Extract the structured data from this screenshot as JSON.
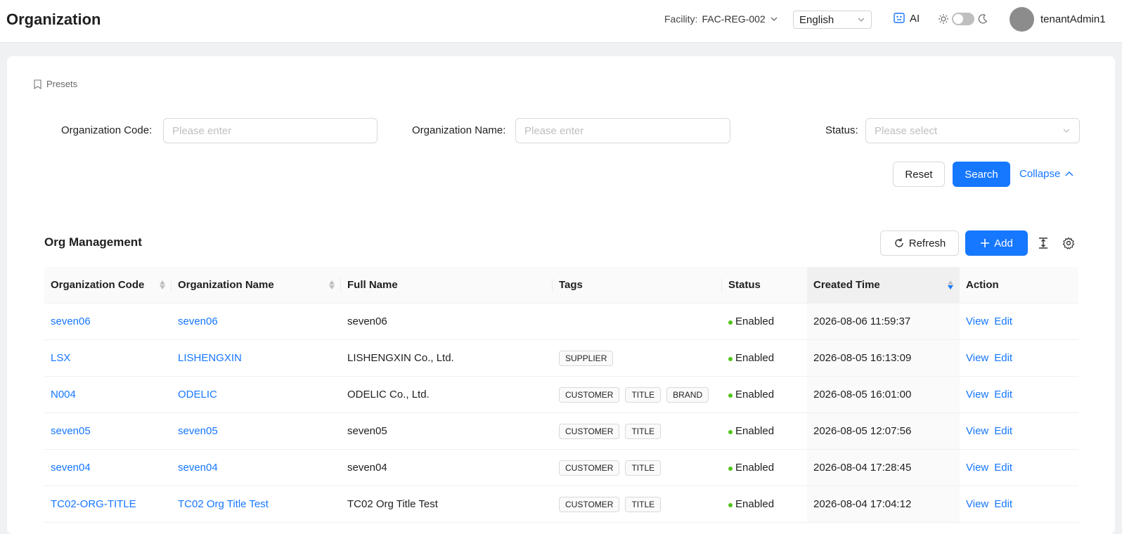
{
  "header": {
    "title": "Organization",
    "facility_label": "Facility:",
    "facility_value": "FAC-REG-002",
    "language": "English",
    "ai_label": "AI",
    "username": "tenantAdmin1"
  },
  "presets_label": "Presets",
  "filters": {
    "org_code_label": "Organization Code",
    "org_code_placeholder": "Please enter",
    "org_name_label": "Organization Name",
    "org_name_placeholder": "Please enter",
    "status_label": "Status",
    "status_placeholder": "Please select",
    "reset_label": "Reset",
    "search_label": "Search",
    "collapse_label": "Collapse"
  },
  "section": {
    "title": "Org Management",
    "refresh_label": "Refresh",
    "add_label": "Add"
  },
  "table": {
    "columns": [
      "Organization Code",
      "Organization Name",
      "Full Name",
      "Tags",
      "Status",
      "Created Time",
      "Action"
    ],
    "rows": [
      {
        "code": "seven06",
        "name": "seven06",
        "full": "seven06",
        "tags": [],
        "status": "Enabled",
        "created": "2026-08-06 11:59:37",
        "view": "View",
        "edit": "Edit"
      },
      {
        "code": "LSX",
        "name": "LISHENGXIN",
        "full": "LISHENGXIN Co., Ltd.",
        "tags": [
          "SUPPLIER"
        ],
        "status": "Enabled",
        "created": "2026-08-05 16:13:09",
        "view": "View",
        "edit": "Edit"
      },
      {
        "code": "N004",
        "name": "ODELIC",
        "full": "ODELIC Co., Ltd.",
        "tags": [
          "CUSTOMER",
          "TITLE",
          "BRAND"
        ],
        "status": "Enabled",
        "created": "2026-08-05 16:01:00",
        "view": "View",
        "edit": "Edit"
      },
      {
        "code": "seven05",
        "name": "seven05",
        "full": "seven05",
        "tags": [
          "CUSTOMER",
          "TITLE"
        ],
        "status": "Enabled",
        "created": "2026-08-05 12:07:56",
        "view": "View",
        "edit": "Edit"
      },
      {
        "code": "seven04",
        "name": "seven04",
        "full": "seven04",
        "tags": [
          "CUSTOMER",
          "TITLE"
        ],
        "status": "Enabled",
        "created": "2026-08-04 17:28:45",
        "view": "View",
        "edit": "Edit"
      },
      {
        "code": "TC02-ORG-TITLE",
        "name": "TC02 Org Title Test",
        "full": "TC02 Org Title Test",
        "tags": [
          "CUSTOMER",
          "TITLE"
        ],
        "status": "Enabled",
        "created": "2026-08-04 17:04:12",
        "view": "View",
        "edit": "Edit"
      }
    ]
  },
  "colors": {
    "primary": "#1677ff",
    "status_enabled": "#52c41a"
  }
}
